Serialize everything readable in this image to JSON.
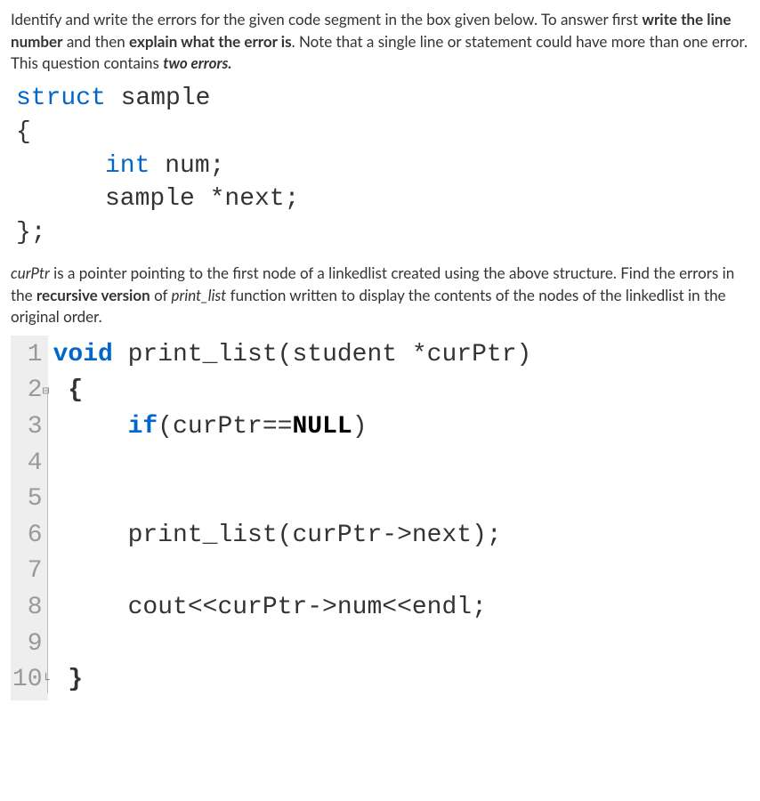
{
  "intro": {
    "p1_a": "Identify and write the errors for the given code segment in the box given below. To answer first ",
    "p1_b": "write the line number",
    "p1_c": " and then ",
    "p1_d": "explain what the error is",
    "p1_e": ".  Note that a single line or statement could have more than one error. This question contains ",
    "p1_f": "two errors.",
    "p1_g": ""
  },
  "struct_code": {
    "l1_kw": "struct",
    "l1_rest": " sample",
    "l2": "{",
    "l3_kw": "int",
    "l3_rest": " num;",
    "l4": "sample *next;",
    "l5": "};"
  },
  "mid": {
    "t1_a": "curPtr",
    "t1_b": " is a pointer pointing to the first node of a linkedlist created using the above structure. Find the errors in the ",
    "t1_c": "recursive version",
    "t1_d": " of ",
    "t1_e": "print_list",
    "t1_f": " function written to display the contents of the nodes of the linkedlist in the original order."
  },
  "lines": {
    "n1": "1",
    "n2": "2",
    "n3": "3",
    "n4": "4",
    "n5": "5",
    "n6": "6",
    "n7": "7",
    "n8": "8",
    "n9": "9",
    "n10": "10"
  },
  "code": {
    "l1_kw": "void",
    "l1_rest": " print_list(student *curPtr)",
    "l2": " {",
    "l3_a": "     ",
    "l3_kw": "if",
    "l3_b": "(curPtr==",
    "l3_null": "NULL",
    "l3_c": ")",
    "l4": " ",
    "l5": " ",
    "l6": "     print_list(curPtr->next);",
    "l7": " ",
    "l8": "     cout<<curPtr->num<<endl;",
    "l9": " ",
    "l10": " }"
  },
  "fold": {
    "open": "⊟",
    "corner": "└"
  }
}
